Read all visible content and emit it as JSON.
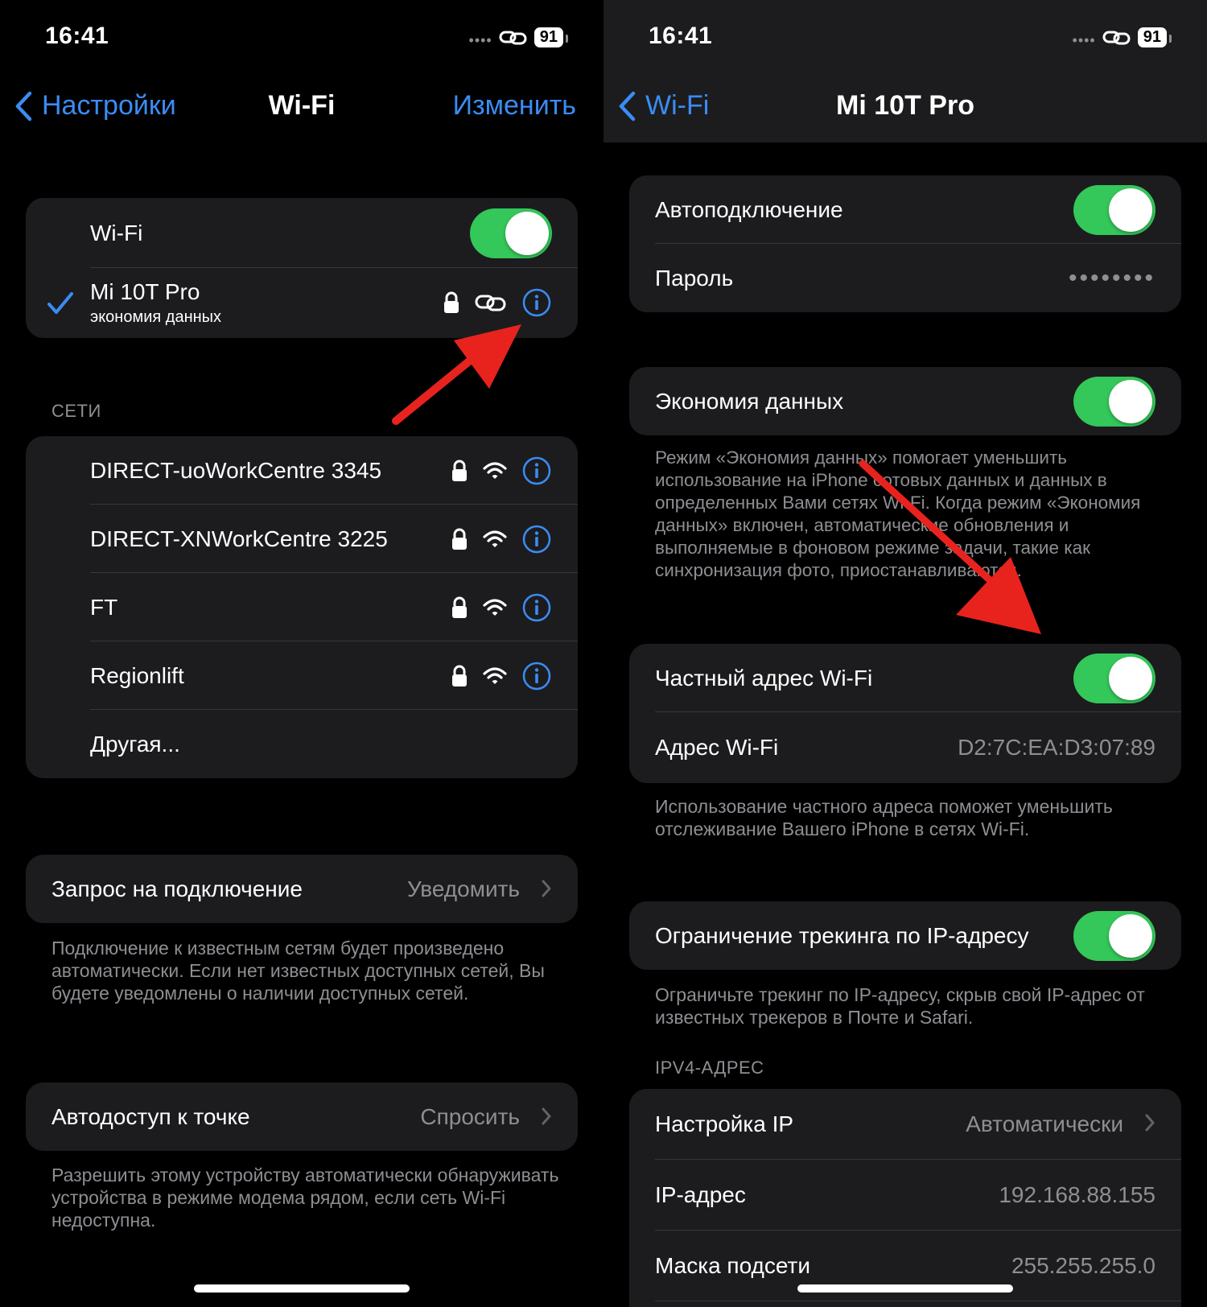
{
  "left": {
    "status": {
      "time": "16:41",
      "battery": "91"
    },
    "nav": {
      "back": "Настройки",
      "title": "Wi-Fi",
      "action": "Изменить"
    },
    "wifi_card": {
      "toggle_label": "Wi-Fi",
      "connected_name": "Mi 10T Pro",
      "connected_sub": "экономия данных"
    },
    "networks_header": "СЕТИ",
    "networks": [
      {
        "name": "DIRECT-uoWorkCentre 3345"
      },
      {
        "name": "DIRECT-XNWorkCentre 3225"
      },
      {
        "name": "FT"
      },
      {
        "name": "Regionlift"
      }
    ],
    "other": "Другая...",
    "ask_join": {
      "label": "Запрос на подключение",
      "value": "Уведомить"
    },
    "ask_join_footer": "Подключение к известным сетям будет произведено автоматически. Если нет известных доступных сетей, Вы будете уведомлены о наличии доступных сетей.",
    "hotspot": {
      "label": "Автодоступ к точке",
      "value": "Спросить"
    },
    "hotspot_footer": "Разрешить этому устройству автоматически обнаруживать устройства в режиме модема рядом, если сеть Wi-Fi недоступна."
  },
  "right": {
    "status": {
      "time": "16:41",
      "battery": "91"
    },
    "nav": {
      "back": "Wi-Fi",
      "title": "Mi 10T Pro"
    },
    "auto_join": "Автоподключение",
    "password": {
      "label": "Пароль",
      "value": "••••••••"
    },
    "low_data": "Экономия данных",
    "low_data_footer": "Режим «Экономия данных» помогает уменьшить использование на iPhone сотовых данных и данных в определенных Вами сетях Wi-Fi. Когда режим «Экономия данных» включен, автоматические обновления и выполняемые в фоновом режиме задачи, такие как синхронизация фото, приостанавливаются.",
    "private_addr": "Частный адрес Wi-Fi",
    "wifi_addr": {
      "label": "Адрес Wi-Fi",
      "value": "D2:7C:EA:D3:07:89"
    },
    "private_footer": "Использование частного адреса поможет уменьшить отслеживание Вашего iPhone в сетях Wi-Fi.",
    "limit_ip": "Ограничение трекинга по IP-адресу",
    "limit_ip_footer": "Ограничьте трекинг по IP-адресу, скрыв свой IP-адрес от известных трекеров в Почте и Safari.",
    "ipv4_header": "IPV4-АДРЕС",
    "configure_ip": {
      "label": "Настройка IP",
      "value": "Автоматически"
    },
    "ip_address": {
      "label": "IP-адрес",
      "value": "192.168.88.155"
    },
    "subnet": {
      "label": "Маска подсети",
      "value": "255.255.255.0"
    }
  },
  "colors": {
    "accent": "#3b8cf5",
    "toggle_on": "#34c759",
    "arrow": "#e8231e",
    "card": "#1c1c1e"
  }
}
